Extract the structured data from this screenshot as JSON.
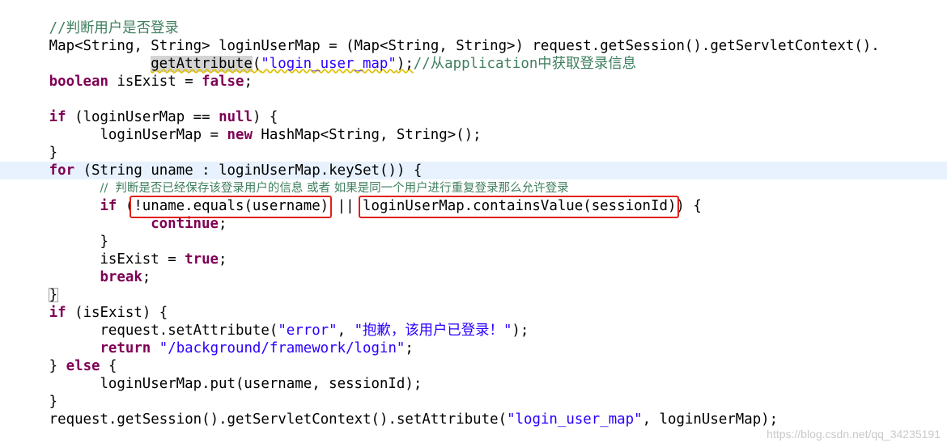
{
  "colors": {
    "keyword": "#7f0055",
    "string": "#2a00ff",
    "comment": "#3f7f5f",
    "current_line": "#e8f2fe",
    "annotation_box": "#e0221a"
  },
  "code_lines": [
    {
      "indent": 8,
      "tokens": [
        {
          "t": "cmt",
          "v": "//判断用户是否登录"
        }
      ]
    },
    {
      "indent": 8,
      "tokens": [
        {
          "t": "plain",
          "v": "Map<String, String> loginUserMap = (Map<String, String>) request.getSession().getServletContext()."
        }
      ]
    },
    {
      "indent": 20,
      "tokens": [
        {
          "t": "plain",
          "v": "getAttribute",
          "hl": true,
          "sq": true
        },
        {
          "t": "plain",
          "v": "(",
          "sq": true
        },
        {
          "t": "str",
          "v": "\"login_user_map\"",
          "sq": true
        },
        {
          "t": "plain",
          "v": ");",
          "sq": true
        },
        {
          "t": "cmt",
          "v": "//从application中获取登录信息"
        }
      ]
    },
    {
      "indent": 8,
      "tokens": [
        {
          "t": "kw",
          "v": "boolean"
        },
        {
          "t": "plain",
          "v": " isExist = "
        },
        {
          "t": "kw",
          "v": "false"
        },
        {
          "t": "plain",
          "v": ";"
        }
      ]
    },
    {
      "indent": 8,
      "tokens": []
    },
    {
      "indent": 8,
      "tokens": [
        {
          "t": "kw",
          "v": "if"
        },
        {
          "t": "plain",
          "v": " (loginUserMap == "
        },
        {
          "t": "kw",
          "v": "null"
        },
        {
          "t": "plain",
          "v": ") {"
        }
      ]
    },
    {
      "indent": 14,
      "tokens": [
        {
          "t": "plain",
          "v": "loginUserMap = "
        },
        {
          "t": "kw",
          "v": "new"
        },
        {
          "t": "plain",
          "v": " HashMap<String, String>();"
        }
      ]
    },
    {
      "indent": 8,
      "tokens": [
        {
          "t": "plain",
          "v": "}"
        }
      ]
    },
    {
      "indent": 8,
      "current": true,
      "tokens": [
        {
          "t": "kw",
          "v": "for"
        },
        {
          "t": "plain",
          "v": " (String uname : loginUserMap.keySet()) {"
        }
      ]
    },
    {
      "indent": 14,
      "small": true,
      "tokens": [
        {
          "t": "cmt",
          "v": "//  判断是否已经保存该登录用户的信息 或者 如果是同一个用户进行重复登录那么允许登录"
        }
      ]
    },
    {
      "indent": 14,
      "tokens": [
        {
          "t": "kw",
          "v": "if"
        },
        {
          "t": "plain",
          "v": " (!uname.equals(username) || loginUserMap.containsValue(sessionId)) {"
        }
      ]
    },
    {
      "indent": 20,
      "tokens": [
        {
          "t": "kw",
          "v": "continue"
        },
        {
          "t": "plain",
          "v": ";"
        }
      ]
    },
    {
      "indent": 14,
      "tokens": [
        {
          "t": "plain",
          "v": "}"
        }
      ]
    },
    {
      "indent": 14,
      "tokens": [
        {
          "t": "plain",
          "v": "isExist = "
        },
        {
          "t": "kw",
          "v": "true"
        },
        {
          "t": "plain",
          "v": ";"
        }
      ]
    },
    {
      "indent": 14,
      "tokens": [
        {
          "t": "kw",
          "v": "break"
        },
        {
          "t": "plain",
          "v": ";"
        }
      ]
    },
    {
      "indent": 8,
      "bracket": true,
      "tokens": [
        {
          "t": "plain",
          "v": "}"
        }
      ]
    },
    {
      "indent": 8,
      "tokens": [
        {
          "t": "kw",
          "v": "if"
        },
        {
          "t": "plain",
          "v": " (isExist) {"
        }
      ]
    },
    {
      "indent": 14,
      "tokens": [
        {
          "t": "plain",
          "v": "request.setAttribute("
        },
        {
          "t": "str",
          "v": "\"error\""
        },
        {
          "t": "plain",
          "v": ", "
        },
        {
          "t": "str",
          "v": "\"抱歉，该用户已登录！\""
        },
        {
          "t": "plain",
          "v": ");"
        }
      ]
    },
    {
      "indent": 14,
      "tokens": [
        {
          "t": "kw",
          "v": "return"
        },
        {
          "t": "plain",
          "v": " "
        },
        {
          "t": "str",
          "v": "\"/background/framework/login\""
        },
        {
          "t": "plain",
          "v": ";"
        }
      ]
    },
    {
      "indent": 8,
      "tokens": [
        {
          "t": "plain",
          "v": "} "
        },
        {
          "t": "kw",
          "v": "else"
        },
        {
          "t": "plain",
          "v": " {"
        }
      ]
    },
    {
      "indent": 14,
      "tokens": [
        {
          "t": "plain",
          "v": "loginUserMap.put(username, sessionId);"
        }
      ]
    },
    {
      "indent": 8,
      "tokens": [
        {
          "t": "plain",
          "v": "}"
        }
      ]
    },
    {
      "indent": 8,
      "tokens": [
        {
          "t": "plain",
          "v": "request.getSession().getServletContext().setAttribute("
        },
        {
          "t": "str",
          "v": "\"login_user_map\""
        },
        {
          "t": "plain",
          "v": ", loginUserMap);"
        }
      ]
    }
  ],
  "annotations": [
    {
      "name": "highlight-box-uname-equals",
      "text": "!uname.equals(username)"
    },
    {
      "name": "highlight-box-contains-value",
      "text": "loginUserMap.containsValue(sessionId)"
    }
  ],
  "watermark": "https://blog.csdn.net/qq_34235191"
}
